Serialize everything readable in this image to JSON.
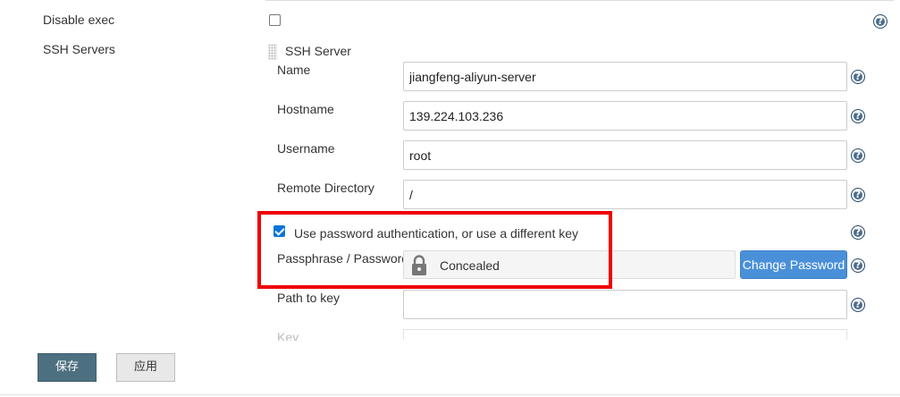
{
  "disable_exec": {
    "label": "Disable exec",
    "checked": false
  },
  "ssh_servers": {
    "label": "SSH Servers"
  },
  "ssh_server": {
    "header": "SSH Server",
    "name": {
      "label": "Name",
      "value": "jiangfeng-aliyun-server"
    },
    "hostname": {
      "label": "Hostname",
      "value": "139.224.103.236"
    },
    "username": {
      "label": "Username",
      "value": "root"
    },
    "remote_directory": {
      "label": "Remote Directory",
      "value": "/"
    },
    "use_password": {
      "label": "Use password authentication, or use a different key",
      "checked": true
    },
    "passphrase": {
      "label": "Passphrase / Password",
      "value": "Concealed",
      "change_button": "Change Password"
    },
    "path_to_key": {
      "label": "Path to key",
      "value": ""
    },
    "key": {
      "label": "Key"
    }
  },
  "help_icon_glyph": "?",
  "actions": {
    "save": "保存",
    "apply": "应用"
  },
  "colors": {
    "highlight": "#ee0000",
    "primary_button": "#4a90d9",
    "save_button": "#4d7080",
    "checkbox_checked": "#0a75d9"
  },
  "icons": [
    "help-icon",
    "lock-icon",
    "drag-handle-icon"
  ]
}
